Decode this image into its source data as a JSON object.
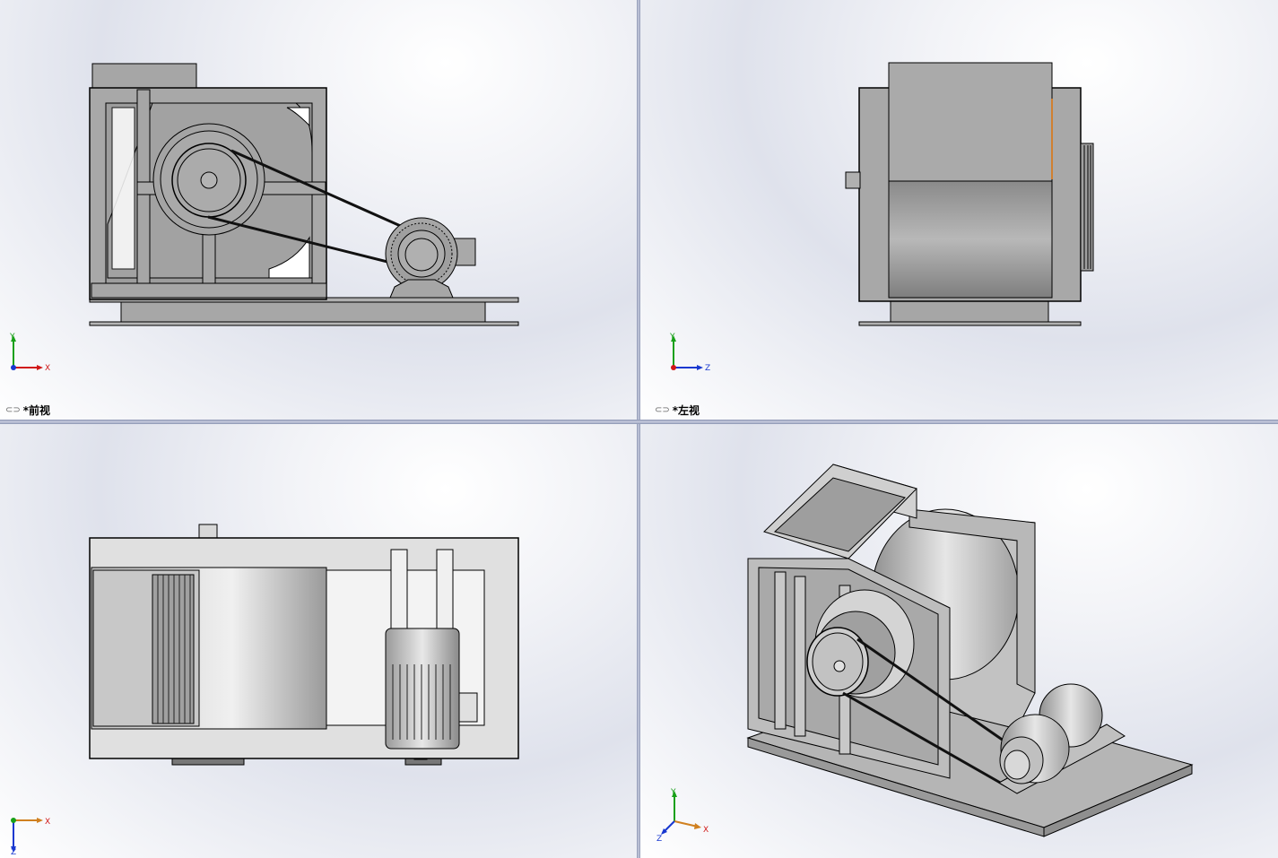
{
  "viewports": [
    {
      "id": "front",
      "label": "*前视",
      "axes": {
        "horizontal": "X",
        "vertical": "Y"
      }
    },
    {
      "id": "left",
      "label": "*左视",
      "axes": {
        "horizontal": "Z",
        "vertical": "Y"
      }
    },
    {
      "id": "top",
      "label": "",
      "axes": {
        "horizontal": "X",
        "vertical": "Z"
      }
    },
    {
      "id": "iso",
      "label": "",
      "axes": {
        "horizontal": "X",
        "vertical": "Y",
        "depth": "Z"
      }
    }
  ],
  "icons": {
    "link": "link-icon"
  },
  "colors": {
    "axis_x": "#d01818",
    "axis_y": "#18a018",
    "axis_z": "#1838d0",
    "part_fill": "#a9a9a9",
    "edge": "#000000"
  }
}
